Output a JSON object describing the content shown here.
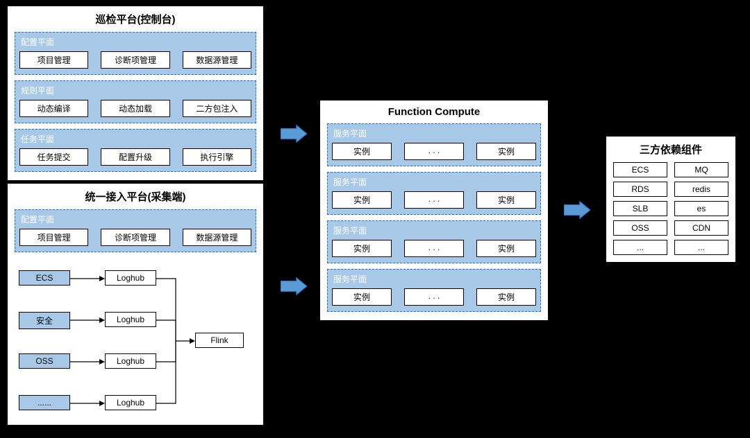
{
  "panels": {
    "inspect": {
      "title": "巡检平台(控制台)",
      "planes": [
        {
          "title": "配置平面",
          "items": [
            "项目管理",
            "诊断项管理",
            "数据源管理"
          ]
        },
        {
          "title": "规则平面",
          "items": [
            "动态编译",
            "动态加载",
            "二方包注入"
          ]
        },
        {
          "title": "任务平面",
          "items": [
            "任务提交",
            "配置升级",
            "执行引擎"
          ]
        }
      ]
    },
    "ingest": {
      "title": "统一接入平台(采集端)",
      "plane": {
        "title": "配置平面",
        "items": [
          "项目管理",
          "诊断项管理",
          "数据源管理"
        ]
      },
      "sources": [
        "ECS",
        "安全",
        "OSS",
        "......"
      ],
      "loghub": "Loghub",
      "flink": "Flink"
    },
    "fc": {
      "title": "Function Compute",
      "plane_title": "服务平面",
      "instance": "实例",
      "ellipsis": ". . ."
    },
    "dep": {
      "title": "三方依赖组件",
      "items": [
        "ECS",
        "MQ",
        "RDS",
        "redis",
        "SLB",
        "es",
        "OSS",
        "CDN",
        "...",
        "..."
      ]
    }
  }
}
